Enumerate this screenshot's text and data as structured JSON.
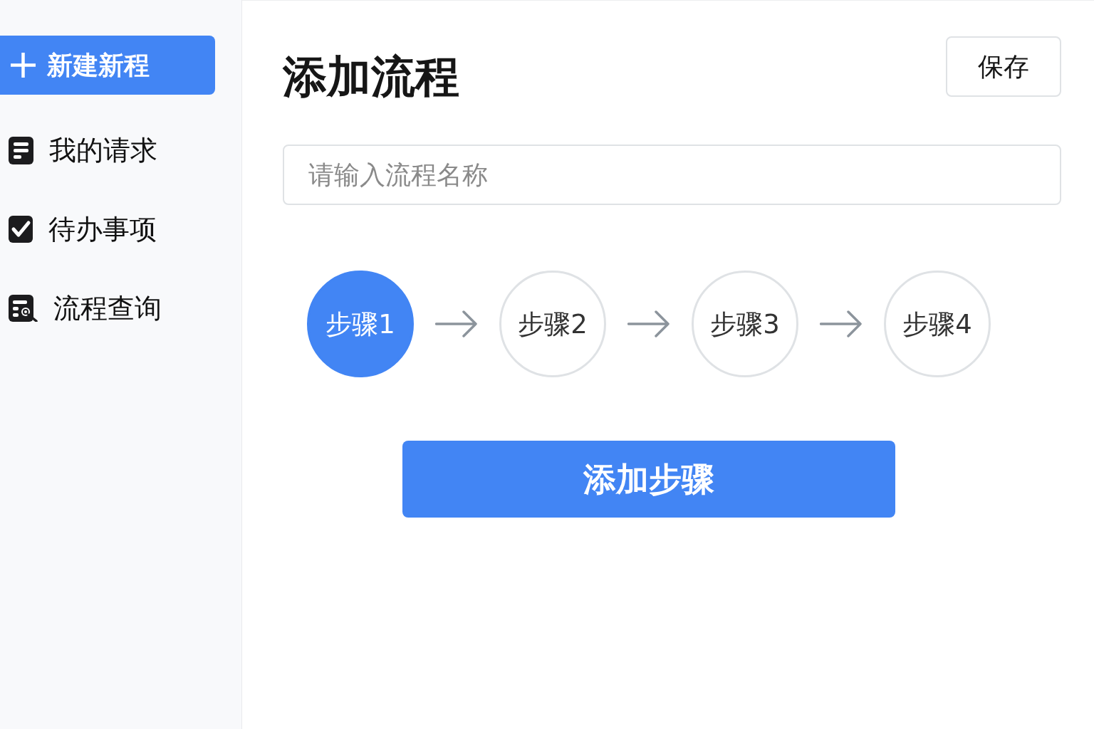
{
  "sidebar": {
    "new_button": {
      "label": "新建新程"
    },
    "items": [
      {
        "label": "我的请求"
      },
      {
        "label": "待办事项"
      },
      {
        "label": "流程查询"
      }
    ]
  },
  "main": {
    "title": "添加流程",
    "save_button": "保存",
    "name_field": {
      "placeholder": "请输入流程名称"
    },
    "steps": [
      {
        "label": "步骤1",
        "selected": true
      },
      {
        "label": "步骤2",
        "selected": false
      },
      {
        "label": "步骤3",
        "selected": false
      },
      {
        "label": "步骤4",
        "selected": false
      }
    ],
    "add_step_button": "添加步骤"
  }
}
